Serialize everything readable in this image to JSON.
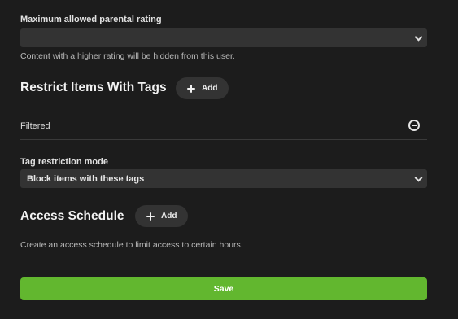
{
  "parental_rating": {
    "label": "Maximum allowed parental rating",
    "value": "",
    "helper": "Content with a higher rating will be hidden from this user."
  },
  "tags_section": {
    "title": "Restrict Items With Tags",
    "add_label": "Add",
    "filtered_label": "Filtered"
  },
  "tag_mode": {
    "label": "Tag restriction mode",
    "value": "Block items with these tags"
  },
  "schedule_section": {
    "title": "Access Schedule",
    "add_label": "Add",
    "helper": "Create an access schedule to limit access to certain hours."
  },
  "save_label": "Save",
  "colors": {
    "background": "#1c1c1c",
    "control": "#333333",
    "save_accent": "#62b72f"
  }
}
